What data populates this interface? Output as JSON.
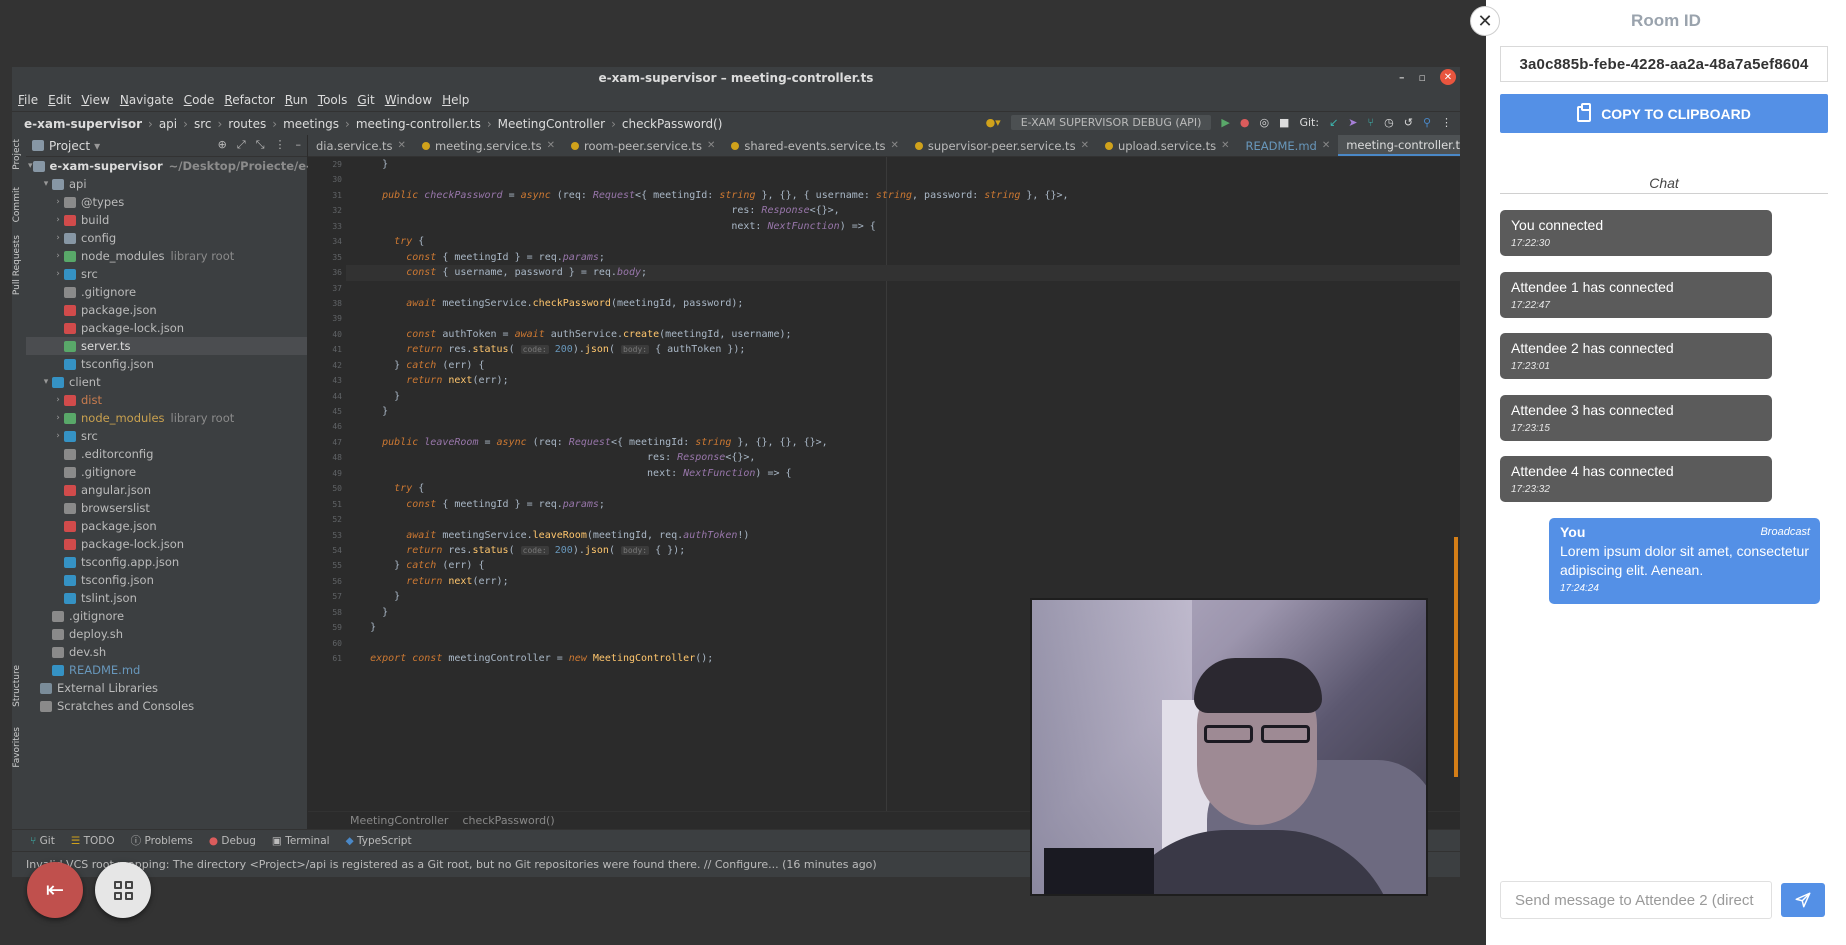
{
  "ide": {
    "title": "e-xam-supervisor – meeting-controller.ts",
    "menu": [
      "File",
      "Edit",
      "View",
      "Navigate",
      "Code",
      "Refactor",
      "Run",
      "Tools",
      "Git",
      "Window",
      "Help"
    ],
    "breadcrumbs": [
      "e-xam-supervisor",
      "api",
      "src",
      "routes",
      "meetings",
      "meeting-controller.ts",
      "MeetingController",
      "checkPassword()"
    ],
    "run_config": "E-XAM SUPERVISOR DEBUG (API)",
    "git_label": "Git:",
    "project_label": "Project",
    "side_labels": [
      "Project",
      "Commit",
      "Pull Requests",
      "Structure",
      "Favorites"
    ],
    "tree": [
      {
        "label": "e-xam-supervisor",
        "extra": "~/Desktop/Proiecte/e-xam-supervisor"
      },
      {
        "label": "api"
      },
      {
        "label": "@types"
      },
      {
        "label": "build"
      },
      {
        "label": "config"
      },
      {
        "label": "node_modules",
        "extra": "library root"
      },
      {
        "label": "src"
      },
      {
        "label": ".gitignore"
      },
      {
        "label": "package.json"
      },
      {
        "label": "package-lock.json"
      },
      {
        "label": "server.ts"
      },
      {
        "label": "tsconfig.json"
      },
      {
        "label": "client"
      },
      {
        "label": "dist"
      },
      {
        "label": "node_modules",
        "extra": "library root"
      },
      {
        "label": "src"
      },
      {
        "label": ".editorconfig"
      },
      {
        "label": ".gitignore"
      },
      {
        "label": "angular.json"
      },
      {
        "label": "browserslist"
      },
      {
        "label": "package.json"
      },
      {
        "label": "package-lock.json"
      },
      {
        "label": "tsconfig.app.json"
      },
      {
        "label": "tsconfig.json"
      },
      {
        "label": "tslint.json"
      },
      {
        "label": ".gitignore"
      },
      {
        "label": "deploy.sh"
      },
      {
        "label": "dev.sh"
      },
      {
        "label": "README.md"
      },
      {
        "label": "External Libraries"
      },
      {
        "label": "Scratches and Consoles"
      }
    ],
    "tabs": [
      "dia.service.ts",
      "meeting.service.ts",
      "room-peer.service.ts",
      "shared-events.service.ts",
      "supervisor-peer.service.ts",
      "upload.service.ts",
      "README.md",
      "meeting-controller.ts"
    ],
    "gutter": [
      "29",
      "30",
      "31",
      "32",
      "33",
      "34",
      "35",
      "36",
      "37",
      "38",
      "39",
      "40",
      "41",
      "42",
      "43",
      "44",
      "45",
      "46",
      "47",
      "48",
      "49",
      "50",
      "51",
      "52",
      "53",
      "54",
      "55",
      "56",
      "57",
      "58",
      "59",
      "60",
      "61"
    ],
    "code_crumbs": [
      "MeetingController",
      "checkPassword()"
    ],
    "tool_windows": [
      "Git",
      "TODO",
      "Problems",
      "Debug",
      "Terminal",
      "TypeScript"
    ],
    "status": "Invalid VCS root mapping: The directory <Project>/api is registered as a Git root, but no Git repositories were found there. // Configure... (16 minutes ago)"
  },
  "panel": {
    "room_title": "Room ID",
    "room_id": "3a0c885b-febe-4228-aa2a-48a7a5ef8604",
    "copy_label": "COPY TO CLIPBOARD",
    "chat_title": "Chat",
    "messages": [
      {
        "text": "You connected",
        "time": "17:22:30"
      },
      {
        "text": "Attendee 1 has connected",
        "time": "17:22:47"
      },
      {
        "text": "Attendee 2 has connected",
        "time": "17:23:01"
      },
      {
        "text": "Attendee 3 has connected",
        "time": "17:23:15"
      },
      {
        "text": "Attendee 4 has connected",
        "time": "17:23:32"
      }
    ],
    "own_message": {
      "sender": "You",
      "scope": "Broadcast",
      "text": "Lorem ipsum dolor sit amet, consectetur adipiscing elit. Aenean.",
      "time": "17:24:24"
    },
    "input_placeholder": "Send message to Attendee 2 (direct"
  },
  "colors": {
    "accent": "#5490e6",
    "leave": "#c0504d",
    "message_bg": "#5b5b5b"
  }
}
